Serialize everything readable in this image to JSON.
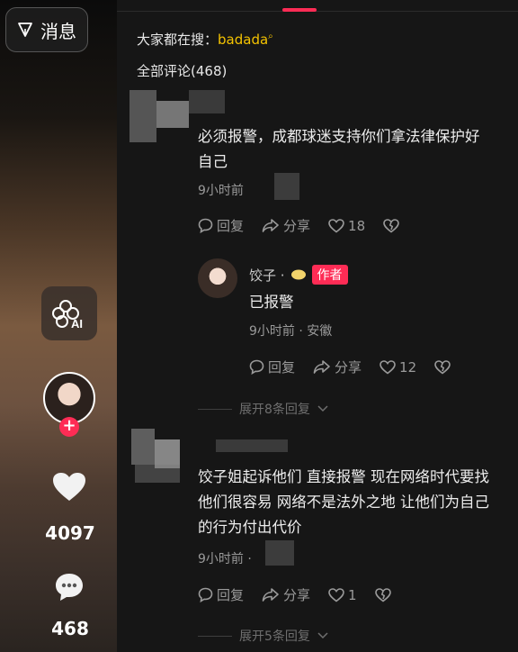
{
  "sidebar": {
    "message_button": "消息",
    "ai_label": "AI",
    "like_count": "4097",
    "comment_count": "468"
  },
  "header": {
    "search_prefix": "大家都在搜：",
    "search_keyword": "badada",
    "comments_label": "全部评论(468)"
  },
  "comments": [
    {
      "text_line1": "必须报警，成都球迷支持你们拿法律保护好",
      "text_line2": "自己",
      "time": "9小时前",
      "reply_label": "回复",
      "share_label": "分享",
      "likes": "18"
    },
    {
      "text_line1": "饺子姐起诉他们 直接报警 现在网络时代要找",
      "text_line2": "他们很容易 网络不是法外之地 让他们为自己",
      "text_line3": "的行为付出代价",
      "time": "9小时前 ·",
      "reply_label": "回复",
      "share_label": "分享",
      "likes": "1"
    }
  ],
  "reply": {
    "name": "饺子 ·",
    "badge": "作者",
    "text": "已报警",
    "time_loc": "9小时前 · 安徽",
    "reply_label": "回复",
    "share_label": "分享",
    "likes": "12"
  },
  "expanders": {
    "first": "展开8条回复",
    "second": "展开5条回复"
  },
  "colors": {
    "accent": "#fe2c55",
    "keyword": "#f4c300"
  }
}
